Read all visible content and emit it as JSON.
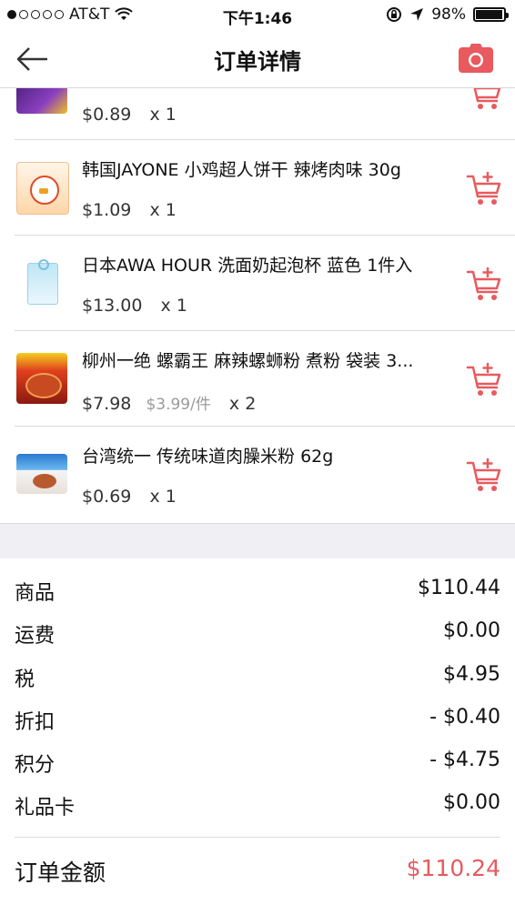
{
  "status_bar": {
    "carrier": "AT&T",
    "time": "下午1:46",
    "battery": "98%",
    "battery_level": 0.98
  },
  "nav": {
    "title": "订单详情",
    "back_icon": "back-arrow-icon",
    "camera_icon": "camera-icon"
  },
  "items": [
    {
      "name": "",
      "price": "$0.89",
      "unit_price": "",
      "qty": "x 1",
      "thumb_color": "#5a2a8a"
    },
    {
      "name": "韩国JAYONE 小鸡超人饼干 辣烤肉味 30g",
      "price": "$1.09",
      "unit_price": "",
      "qty": "x 1",
      "thumb_color": "#f08a2a"
    },
    {
      "name": "日本AWA HOUR 洗面奶起泡杯 蓝色 1件入",
      "price": "$13.00",
      "unit_price": "",
      "qty": "x 1",
      "thumb_color": "#6ec3e8"
    },
    {
      "name": "柳州一绝 螺霸王 麻辣螺蛳粉 煮粉 袋装 3...",
      "price": "$7.98",
      "unit_price": "$3.99/件",
      "qty": "x 2",
      "thumb_color": "#c63a1e"
    },
    {
      "name": "台湾统一 传统味道肉臊米粉 62g",
      "price": "$0.69",
      "unit_price": "",
      "qty": "x 1",
      "thumb_color": "#3a8ad8"
    }
  ],
  "summary": {
    "rows": [
      {
        "label": "商品",
        "value": "$110.44"
      },
      {
        "label": "运费",
        "value": "$0.00"
      },
      {
        "label": "税",
        "value": "$4.95"
      },
      {
        "label": "折扣",
        "value": "- $0.40"
      },
      {
        "label": "积分",
        "value": "- $4.75"
      },
      {
        "label": "礼品卡",
        "value": "$0.00"
      }
    ],
    "total_label": "订单金额",
    "total_value": "$110.24"
  },
  "colors": {
    "accent": "#e85a5e",
    "divider": "#dcdcdc",
    "band": "#efeff4"
  }
}
